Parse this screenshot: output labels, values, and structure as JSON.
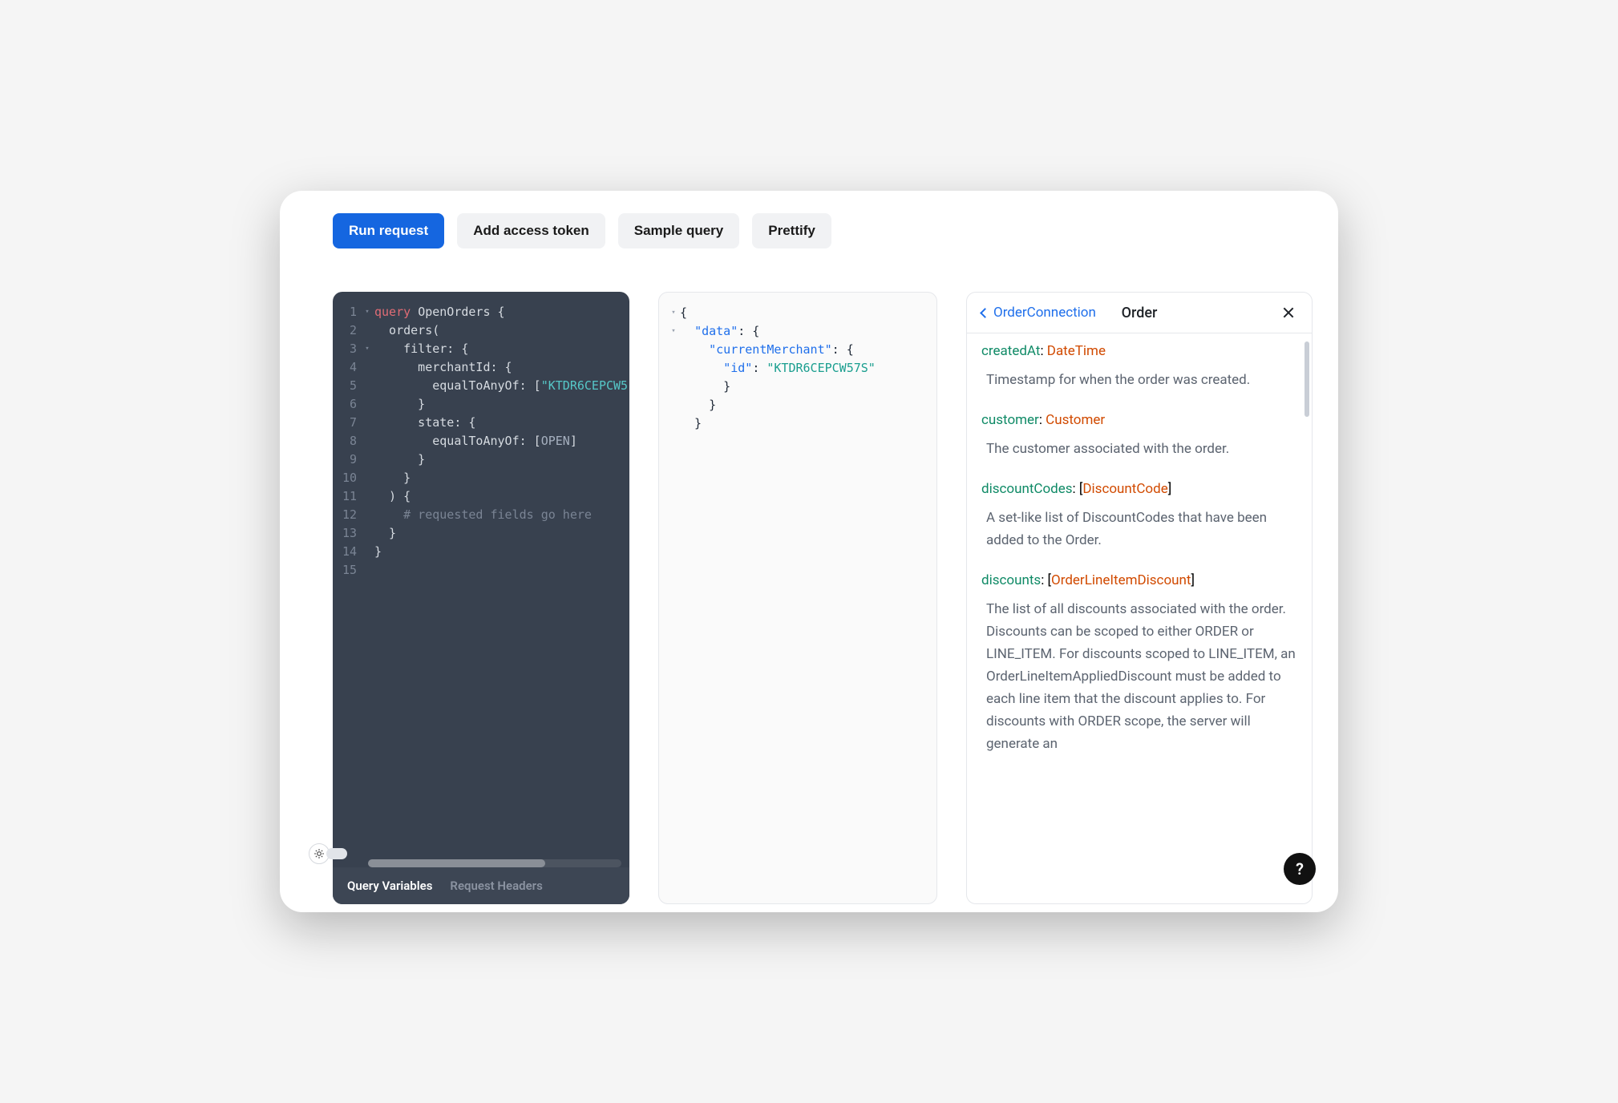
{
  "toolbar": {
    "run": "Run request",
    "token": "Add access token",
    "sample": "Sample query",
    "prettify": "Prettify"
  },
  "editor": {
    "lines": [
      {
        "num": "1",
        "fold": "▾",
        "html": "<span class='kw'>query</span> <span class='fn'>OpenOrders</span> {"
      },
      {
        "num": "2",
        "fold": "",
        "html": "  orders("
      },
      {
        "num": "3",
        "fold": "▾",
        "html": "    filter: {"
      },
      {
        "num": "4",
        "fold": "",
        "html": "      merchantId: {"
      },
      {
        "num": "5",
        "fold": "",
        "html": "        equalToAnyOf: [<span class='str'>\"KTDR6CEPCW5</span>"
      },
      {
        "num": "6",
        "fold": "",
        "html": "      }"
      },
      {
        "num": "7",
        "fold": "",
        "html": "      state: {"
      },
      {
        "num": "8",
        "fold": "",
        "html": "        equalToAnyOf: [<span class='enum'>OPEN</span>]"
      },
      {
        "num": "9",
        "fold": "",
        "html": "      }"
      },
      {
        "num": "10",
        "fold": "",
        "html": "    }"
      },
      {
        "num": "11",
        "fold": "",
        "html": "  ) {"
      },
      {
        "num": "12",
        "fold": "",
        "html": "    <span class='cmt'># requested fields go here</span>"
      },
      {
        "num": "13",
        "fold": "",
        "html": "  }"
      },
      {
        "num": "14",
        "fold": "",
        "html": "}"
      },
      {
        "num": "15",
        "fold": "",
        "html": ""
      }
    ],
    "tabs": {
      "vars": "Query Variables",
      "headers": "Request Headers"
    }
  },
  "response": {
    "lines": [
      {
        "fold": "▾",
        "html": "{"
      },
      {
        "fold": "▾",
        "html": "  <span class='jkey'>\"data\"</span>: {"
      },
      {
        "fold": "",
        "html": "    <span class='jkey'>\"currentMerchant\"</span>: {"
      },
      {
        "fold": "",
        "html": "      <span class='jkey'>\"id\"</span>: <span class='jstr'>\"KTDR6CEPCW57S\"</span>"
      },
      {
        "fold": "",
        "html": "      }"
      },
      {
        "fold": "",
        "html": "    }"
      },
      {
        "fold": "",
        "html": "  }"
      }
    ]
  },
  "docs": {
    "back_label": "OrderConnection",
    "title": "Order",
    "fields": [
      {
        "name": "createdAt",
        "sep": ": ",
        "pre": "",
        "type": "DateTime",
        "post": "",
        "desc": "Timestamp for when the order was created."
      },
      {
        "name": "customer",
        "sep": ": ",
        "pre": "",
        "type": "Customer",
        "post": "",
        "desc": "The customer associated with the order."
      },
      {
        "name": "discountCodes",
        "sep": ": ",
        "pre": "[",
        "type": "DiscountCode",
        "post": "]",
        "desc": "A set-like list of DiscountCodes that have been added to the Order."
      },
      {
        "name": "discounts",
        "sep": ": ",
        "pre": "[",
        "type": "OrderLineItemDiscount",
        "post": "]",
        "desc": "The list of all discounts associated with the order. Discounts can be scoped to either ORDER or LINE_ITEM. For discounts scoped to LINE_ITEM, an OrderLineItemAppliedDiscount must be added to each line item that the discount applies to. For discounts with ORDER scope, the server will generate an"
      }
    ]
  },
  "help": "?"
}
